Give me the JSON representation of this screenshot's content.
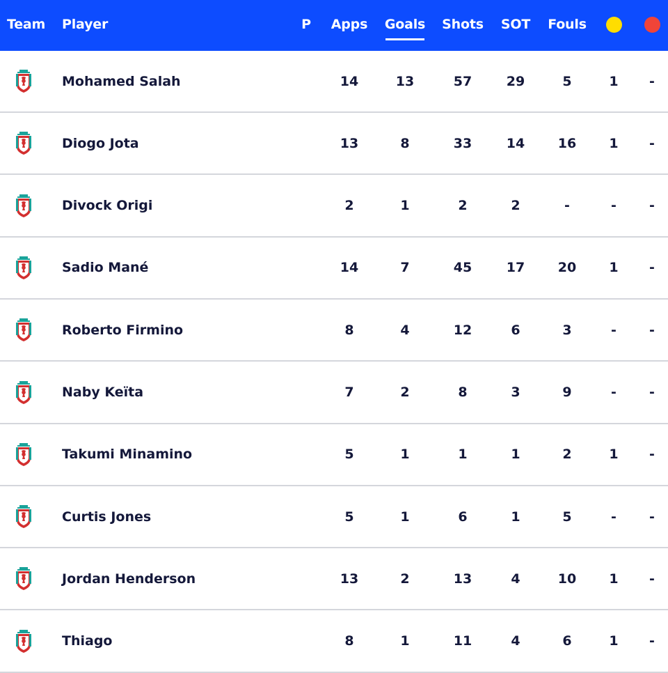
{
  "colors": {
    "header_bg": "#0d4cff",
    "header_text": "#ffffff",
    "yellow_card": "#ffdd00",
    "red_card": "#f04438",
    "crest_red": "#d32f2f",
    "crest_teal": "#1aa39a"
  },
  "header": {
    "team": "Team",
    "player": "Player",
    "position": "P",
    "apps": "Apps",
    "goals": "Goals",
    "shots": "Shots",
    "sot": "SOT",
    "fouls": "Fouls",
    "yellow_icon": "yellow-card-icon",
    "red_icon": "red-card-icon",
    "sorted_column": "Goals"
  },
  "rows": [
    {
      "team_icon": "liverpool-crest-icon",
      "player": "Mohamed Salah",
      "apps": "14",
      "goals": "13",
      "shots": "57",
      "sot": "29",
      "fouls": "5",
      "yellow": "1",
      "red": "-"
    },
    {
      "team_icon": "liverpool-crest-icon",
      "player": "Diogo Jota",
      "apps": "13",
      "goals": "8",
      "shots": "33",
      "sot": "14",
      "fouls": "16",
      "yellow": "1",
      "red": "-"
    },
    {
      "team_icon": "liverpool-crest-icon",
      "player": "Divock Origi",
      "apps": "2",
      "goals": "1",
      "shots": "2",
      "sot": "2",
      "fouls": "-",
      "yellow": "-",
      "red": "-"
    },
    {
      "team_icon": "liverpool-crest-icon",
      "player": "Sadio Mané",
      "apps": "14",
      "goals": "7",
      "shots": "45",
      "sot": "17",
      "fouls": "20",
      "yellow": "1",
      "red": "-"
    },
    {
      "team_icon": "liverpool-crest-icon",
      "player": "Roberto Firmino",
      "apps": "8",
      "goals": "4",
      "shots": "12",
      "sot": "6",
      "fouls": "3",
      "yellow": "-",
      "red": "-"
    },
    {
      "team_icon": "liverpool-crest-icon",
      "player": "Naby Keïta",
      "apps": "7",
      "goals": "2",
      "shots": "8",
      "sot": "3",
      "fouls": "9",
      "yellow": "-",
      "red": "-"
    },
    {
      "team_icon": "liverpool-crest-icon",
      "player": "Takumi Minamino",
      "apps": "5",
      "goals": "1",
      "shots": "1",
      "sot": "1",
      "fouls": "2",
      "yellow": "1",
      "red": "-"
    },
    {
      "team_icon": "liverpool-crest-icon",
      "player": "Curtis Jones",
      "apps": "5",
      "goals": "1",
      "shots": "6",
      "sot": "1",
      "fouls": "5",
      "yellow": "-",
      "red": "-"
    },
    {
      "team_icon": "liverpool-crest-icon",
      "player": "Jordan Henderson",
      "apps": "13",
      "goals": "2",
      "shots": "13",
      "sot": "4",
      "fouls": "10",
      "yellow": "1",
      "red": "-"
    },
    {
      "team_icon": "liverpool-crest-icon",
      "player": "Thiago",
      "apps": "8",
      "goals": "1",
      "shots": "11",
      "sot": "4",
      "fouls": "6",
      "yellow": "1",
      "red": "-"
    }
  ]
}
